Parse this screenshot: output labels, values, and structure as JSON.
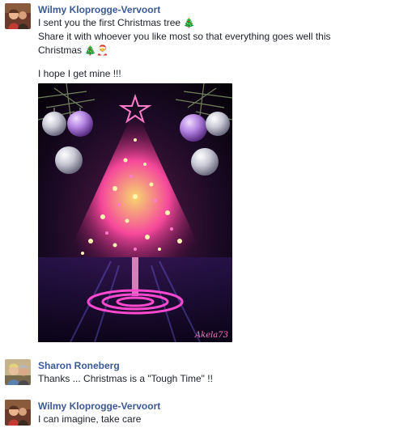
{
  "messages": [
    {
      "author": "Wilmy Kloprogge-Vervoort",
      "lines": [
        "I sent you the first Christmas tree",
        "Share it with whoever you like most so that everything goes well this",
        "Christmas",
        "I hope I get mine !!!"
      ],
      "icons": [
        "christmas-tree-emoji",
        "santa-emoji"
      ],
      "image_signature": "Akela73"
    },
    {
      "author": "Sharon Roneberg",
      "lines": [
        "Thanks ... Christmas is a \"Tough Time\" !!"
      ]
    },
    {
      "author": "Wilmy Kloprogge-Vervoort",
      "lines": [
        "I can imagine, take care"
      ]
    }
  ],
  "colors": {
    "author_name": "#3b5998",
    "text": "#1d2129"
  }
}
